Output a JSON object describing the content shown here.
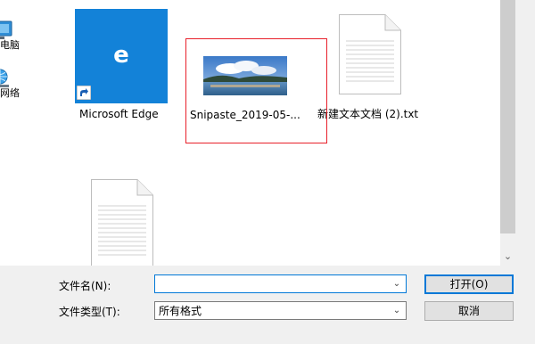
{
  "nav": {
    "items": [
      {
        "label": "电脑",
        "icon": "computer-icon"
      },
      {
        "label": "网络",
        "icon": "network-icon"
      }
    ]
  },
  "files": [
    {
      "name": "Microsoft Edge",
      "icon": "edge-icon",
      "shortcut": true
    },
    {
      "name": "Snipaste_2019-05-...",
      "icon": "image-thumbnail"
    },
    {
      "name": "新建文本文档 (2).txt",
      "icon": "text-file-icon"
    },
    {
      "name": "",
      "icon": "text-file-icon"
    }
  ],
  "form": {
    "filename_label": "文件名(N):",
    "filename_value": "",
    "filetype_label": "文件类型(T):",
    "filetype_value": "所有格式"
  },
  "buttons": {
    "open_label": "打开(O)",
    "cancel_label": "取消"
  },
  "colors": {
    "edge_tile": "#1382d8",
    "selection_highlight": "#e8202a",
    "focus_border": "#0078d7"
  }
}
